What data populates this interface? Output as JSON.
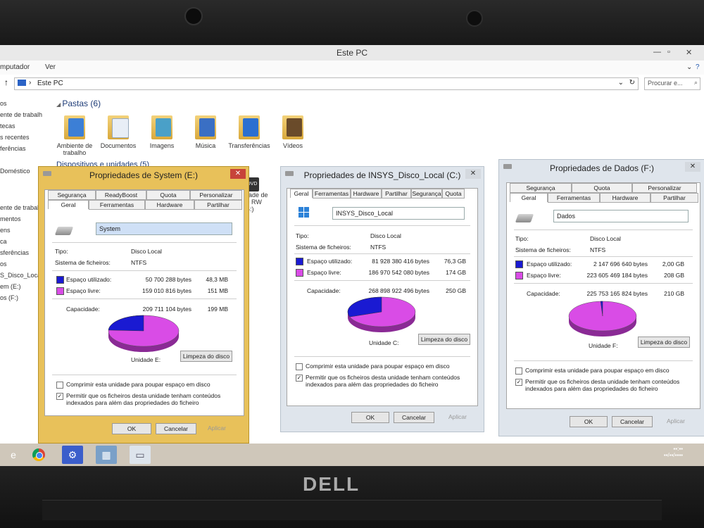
{
  "explorer": {
    "title": "Este PC",
    "ribbon": [
      "mputador",
      "Ver"
    ],
    "address": "Este PC",
    "search_placeholder": "Procurar e...",
    "nav_items": [
      "os",
      "ente de trabalh",
      "tecas",
      "s recentes",
      "ferências",
      "Doméstico",
      "ente de trabal",
      "mentos",
      "ens",
      "ca",
      "sferências",
      "os",
      "S_Disco_Local",
      "em (E:)",
      "os (F:)"
    ],
    "folders_section": "Pastas (6)",
    "devices_section": "Dispositivos e unidades (5)",
    "folders": [
      "Ambiente de trabalho",
      "Documentos",
      "Imagens",
      "Música",
      "Transferências",
      "Vídeos"
    ],
    "partial_device": [
      "DVD",
      "D RW",
      "G:)",
      "dade de"
    ]
  },
  "dialog_e": {
    "title": "Propriedades de System (E:)",
    "tabs_row1": [
      "Segurança",
      "ReadyBoost",
      "Quota",
      "Personalizar"
    ],
    "tabs_row2": [
      "Geral",
      "Ferramentas",
      "Hardware",
      "Partilhar"
    ],
    "name": "System",
    "type_label": "Tipo:",
    "type_value": "Disco Local",
    "fs_label": "Sistema de ficheiros:",
    "fs_value": "NTFS",
    "used_label": "Espaço utilizado:",
    "used_bytes": "50 700 288 bytes",
    "used_size": "48,3 MB",
    "free_label": "Espaço livre:",
    "free_bytes": "159 010 816 bytes",
    "free_size": "151 MB",
    "cap_label": "Capacidade:",
    "cap_bytes": "209 711 104 bytes",
    "cap_size": "199 MB",
    "drive_label": "Unidade E:",
    "cleanup": "Limpeza do disco",
    "compress": "Comprimir esta unidade para poupar espaço em disco",
    "index": "Permitir que os ficheiros desta unidade tenham conteúdos indexados para além das propriedades do ficheiro",
    "ok": "OK",
    "cancel": "Cancelar",
    "apply": "Aplicar",
    "used_fraction": 0.242
  },
  "dialog_c": {
    "title": "Propriedades de INSYS_Disco_Local (C:)",
    "tabs": [
      "Geral",
      "Ferramentas",
      "Hardware",
      "Partilhar",
      "Segurança",
      "Quota"
    ],
    "name": "INSYS_Disco_Local",
    "type_label": "Tipo:",
    "type_value": "Disco Local",
    "fs_label": "Sistema de ficheiros:",
    "fs_value": "NTFS",
    "used_label": "Espaço utilizado:",
    "used_bytes": "81 928 380 416 bytes",
    "used_size": "76,3 GB",
    "free_label": "Espaço livre:",
    "free_bytes": "186 970 542 080 bytes",
    "free_size": "174 GB",
    "cap_label": "Capacidade:",
    "cap_bytes": "268 898 922 496 bytes",
    "cap_size": "250 GB",
    "drive_label": "Unidade C:",
    "cleanup": "Limpeza do disco",
    "compress": "Comprimir esta unidade para poupar espaço em disco",
    "index": "Permitir que os ficheiros desta unidade tenham conteúdos indexados para além das propriedades do ficheiro",
    "ok": "OK",
    "cancel": "Cancelar",
    "apply": "Aplicar",
    "used_fraction": 0.305
  },
  "dialog_f": {
    "title": "Propriedades de Dados (F:)",
    "tabs_row1": [
      "Segurança",
      "Quota",
      "Personalizar"
    ],
    "tabs_row2": [
      "Geral",
      "Ferramentas",
      "Hardware",
      "Partilhar"
    ],
    "name": "Dados",
    "type_label": "Tipo:",
    "type_value": "Disco Local",
    "fs_label": "Sistema de ficheiros:",
    "fs_value": "NTFS",
    "used_label": "Espaço utilizado:",
    "used_bytes": "2 147 696 640 bytes",
    "used_size": "2,00 GB",
    "free_label": "Espaço livre:",
    "free_bytes": "223 605 469 184 bytes",
    "free_size": "208 GB",
    "cap_label": "Capacidade:",
    "cap_bytes": "225 753 165 824 bytes",
    "cap_size": "210 GB",
    "drive_label": "Unidade F:",
    "cleanup": "Limpeza do disco",
    "compress": "Comprimir esta unidade para poupar espaço em disco",
    "index": "Permitir que os ficheiros desta unidade tenham conteúdos indexados para além das propriedades do ficheiro",
    "ok": "OK",
    "cancel": "Cancelar",
    "apply": "Aplicar",
    "used_fraction": 0.0095
  },
  "colors": {
    "used": "#1a1ad2",
    "free": "#d94ce6",
    "active_frame": "#e8c15a",
    "inactive_frame": "#dfe5ec"
  },
  "brand": "DELL",
  "taskbar_icons": [
    "ie-icon",
    "chrome-icon",
    "settings-icon",
    "network-icon",
    "window-icon"
  ]
}
